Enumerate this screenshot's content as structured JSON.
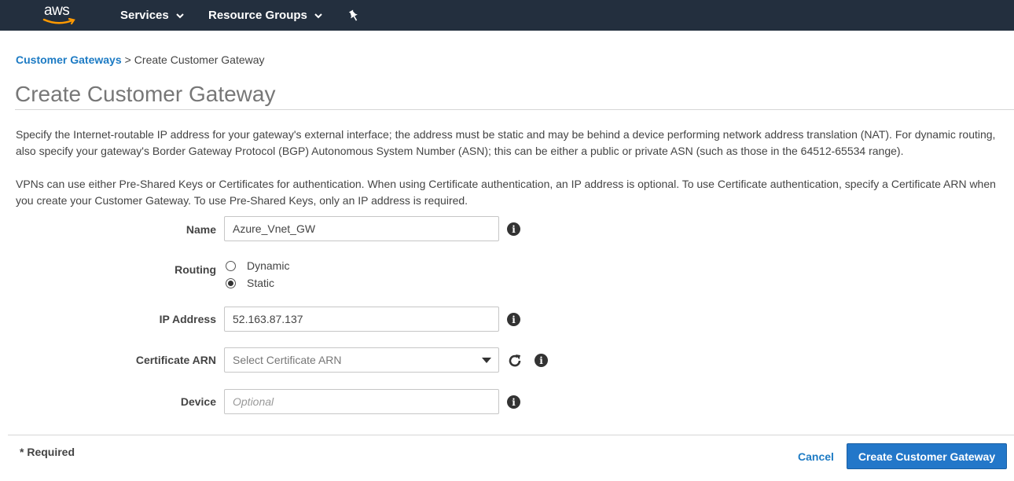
{
  "nav": {
    "logo_text": "aws",
    "services_label": "Services",
    "resource_groups_label": "Resource Groups",
    "pin_icon": "pin-icon"
  },
  "breadcrumb": {
    "parent": "Customer Gateways",
    "separator": ">",
    "current": "Create Customer Gateway"
  },
  "page": {
    "title": "Create Customer Gateway",
    "desc1": "Specify the Internet-routable IP address for your gateway's external interface; the address must be static and may be behind a device performing network address translation (NAT). For dynamic routing, also specify your gateway's Border Gateway Protocol (BGP) Autonomous System Number (ASN); this can be either a public or private ASN (such as those in the 64512-65534 range).",
    "desc2": "VPNs can use either Pre-Shared Keys or Certificates for authentication. When using Certificate authentication, an IP address is optional. To use Certificate authentication, specify a Certificate ARN when you create your Customer Gateway. To use Pre-Shared Keys, only an IP address is required."
  },
  "form": {
    "name": {
      "label": "Name",
      "value": "Azure_Vnet_GW"
    },
    "routing": {
      "label": "Routing",
      "options": [
        "Dynamic",
        "Static"
      ],
      "selected": "Static"
    },
    "ip": {
      "label": "IP Address",
      "value": "52.163.87.137"
    },
    "cert": {
      "label": "Certificate ARN",
      "placeholder": "Select Certificate ARN"
    },
    "device": {
      "label": "Device",
      "placeholder": "Optional"
    },
    "info_symbol": "i"
  },
  "footer": {
    "required": "* Required",
    "cancel": "Cancel",
    "create": "Create Customer Gateway"
  },
  "colors": {
    "nav_bg": "#232f3e",
    "link": "#1d7bc4",
    "primary_button": "#2377c9",
    "aws_orange": "#ff9900"
  }
}
